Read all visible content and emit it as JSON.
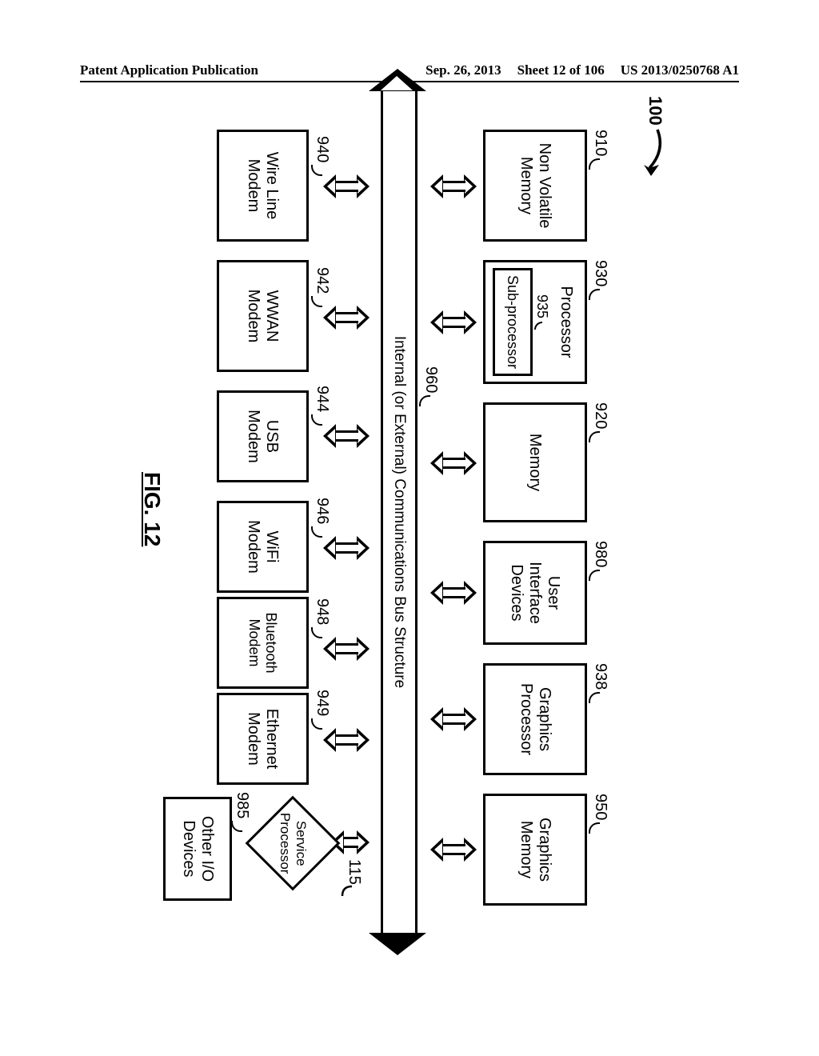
{
  "header": {
    "left": "Patent Application Publication",
    "date": "Sep. 26, 2013",
    "sheet": "Sheet 12 of 106",
    "pubno": "US 2013/0250768 A1"
  },
  "system_ref": "100",
  "bus_label": "Internal (or External) Communications Bus Structure",
  "bus_ref": "960",
  "figure_label": "FIG. 12",
  "top_blocks": [
    {
      "ref": "910",
      "label": "Non Volatile\nMemory"
    },
    {
      "ref": "930",
      "label": "Processor",
      "inner": {
        "ref": "935",
        "label": "Sub-processor"
      }
    },
    {
      "ref": "920",
      "label": "Memory"
    },
    {
      "ref": "980",
      "label": "User\nInterface\nDevices"
    },
    {
      "ref": "938",
      "label": "Graphics\nProcessor"
    },
    {
      "ref": "950",
      "label": "Graphics\nMemory"
    }
  ],
  "bottom_blocks": [
    {
      "ref": "940",
      "label": "Wire Line\nModem"
    },
    {
      "ref": "942",
      "label": "WWAN\nModem"
    },
    {
      "ref": "944",
      "label": "USB\nModem"
    },
    {
      "ref": "946",
      "label": "WiFi\nModem"
    },
    {
      "ref": "948",
      "label": "Bluetooth\nModem"
    },
    {
      "ref": "949",
      "label": "Ethernet\nModem"
    },
    {
      "ref": "985",
      "label": "Other I/O\nDevices"
    }
  ],
  "service_processor": {
    "ref": "115",
    "label": "Service\nProcessor"
  }
}
